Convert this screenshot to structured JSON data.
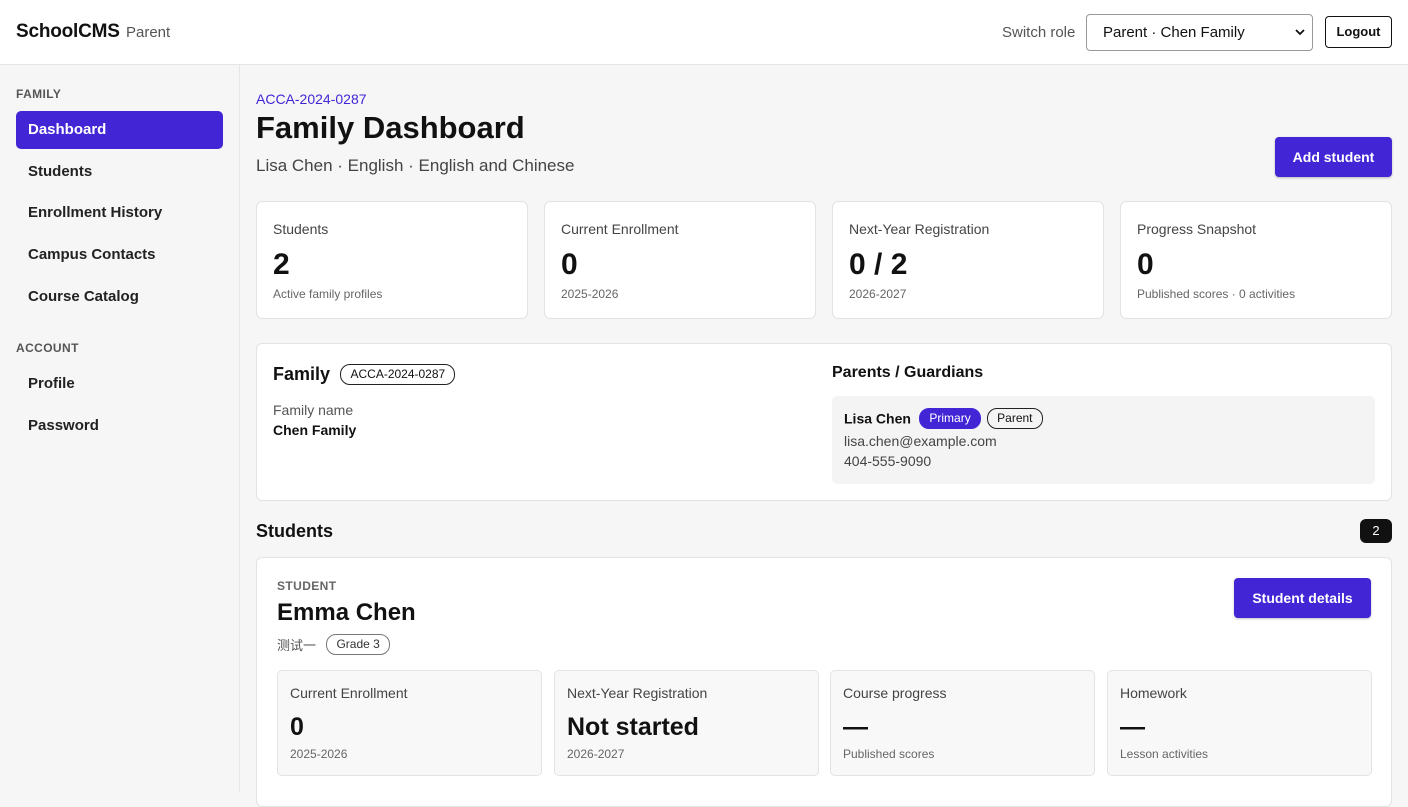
{
  "app": {
    "name": "SchoolCMS",
    "role": "Parent"
  },
  "header": {
    "switch_role_label": "Switch role",
    "role_selected": "Parent · Chen Family",
    "logout_label": "Logout"
  },
  "sidebar": {
    "family_heading": "FAMILY",
    "family_items": [
      {
        "label": "Dashboard",
        "active": true
      },
      {
        "label": "Students"
      },
      {
        "label": "Enrollment History"
      },
      {
        "label": "Campus Contacts"
      },
      {
        "label": "Course Catalog"
      }
    ],
    "account_heading": "ACCOUNT",
    "account_items": [
      {
        "label": "Profile"
      },
      {
        "label": "Password"
      }
    ]
  },
  "page": {
    "family_code": "ACCA-2024-0287",
    "title": "Family Dashboard",
    "subtitle": "Lisa Chen · English · English and Chinese",
    "add_student_label": "Add student"
  },
  "stats": [
    {
      "label": "Students",
      "value": "2",
      "sub": "Active family profiles"
    },
    {
      "label": "Current Enrollment",
      "value": "0",
      "sub": "2025-2026"
    },
    {
      "label": "Next-Year Registration",
      "value": "0 / 2",
      "sub": "2026-2027"
    },
    {
      "label": "Progress Snapshot",
      "value": "0",
      "sub": "Published scores · 0 activities"
    }
  ],
  "family": {
    "heading": "Family",
    "code_badge": "ACCA-2024-0287",
    "name_label": "Family name",
    "name_value": "Chen Family",
    "guardians_heading": "Parents / Guardians",
    "guardian": {
      "name": "Lisa Chen",
      "badge_primary": "Primary",
      "badge_role": "Parent",
      "email": "lisa.chen@example.com",
      "phone": "404-555-9090"
    }
  },
  "students": {
    "heading": "Students",
    "count": "2",
    "student": {
      "eyebrow": "STUDENT",
      "name": "Emma Chen",
      "chinese_name": "测试一",
      "grade": "Grade 3",
      "details_label": "Student details",
      "stats": [
        {
          "label": "Current Enrollment",
          "value": "0",
          "sub": "2025-2026"
        },
        {
          "label": "Next-Year Registration",
          "value": "Not started",
          "sub": "2026-2027"
        },
        {
          "label": "Course progress",
          "value": "—",
          "sub": "Published scores"
        },
        {
          "label": "Homework",
          "value": "—",
          "sub": "Lesson activities"
        }
      ]
    }
  },
  "colors": {
    "accent": "#4226d6",
    "background": "#f6f6f6",
    "card": "#ffffff"
  }
}
